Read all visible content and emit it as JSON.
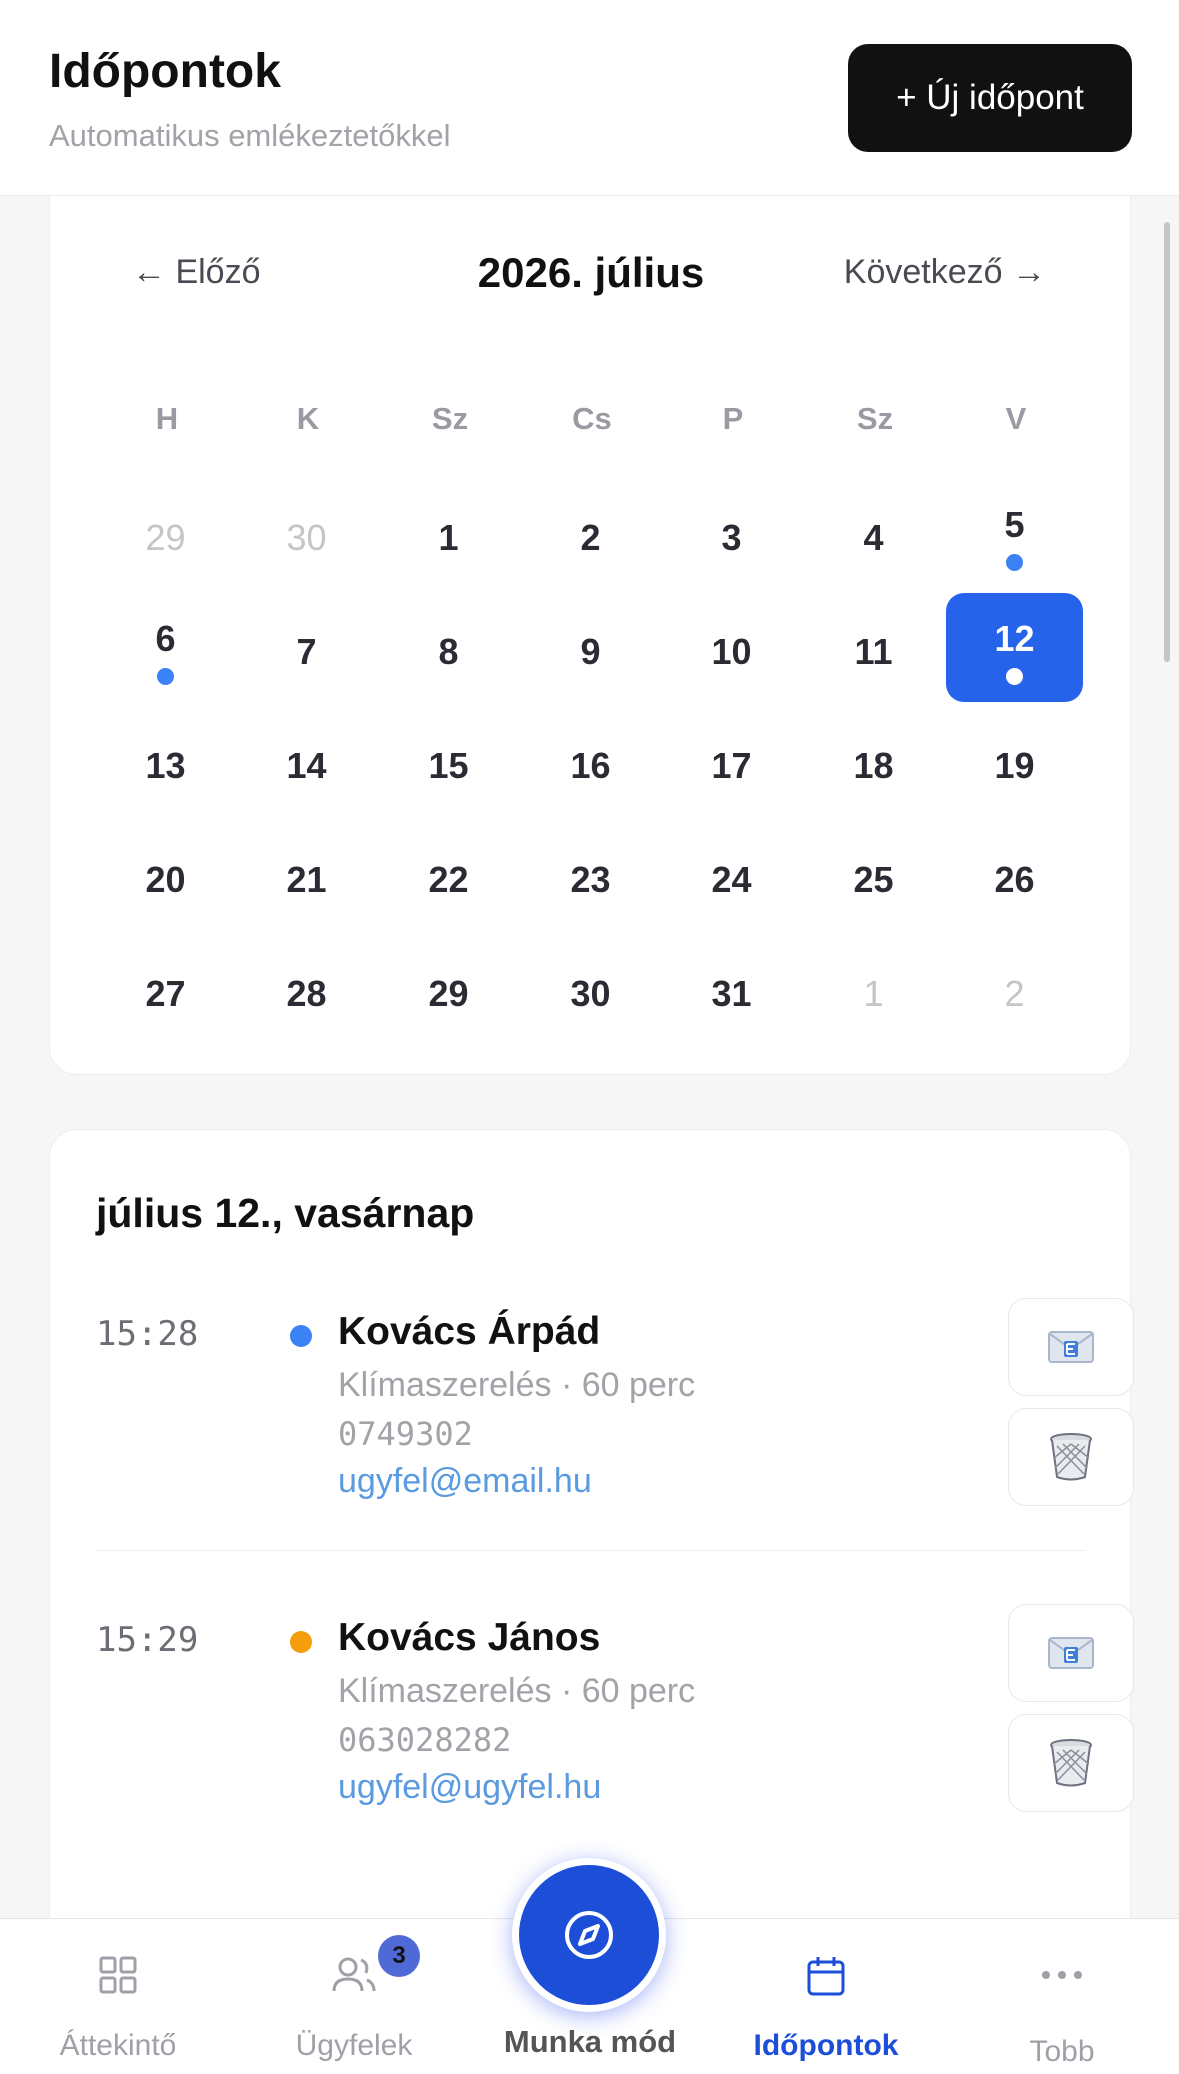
{
  "header": {
    "title": "Időpontok",
    "subtitle": "Automatikus emlékeztetőkkel",
    "new_button": "+ Új időpont"
  },
  "calendar": {
    "prev": "← Előző",
    "month": "2026. július",
    "next": "Következő →",
    "weekdays": [
      "H",
      "K",
      "Sz",
      "Cs",
      "P",
      "Sz",
      "V"
    ],
    "weeks": [
      [
        {
          "d": "29",
          "muted": true
        },
        {
          "d": "30",
          "muted": true
        },
        {
          "d": "1"
        },
        {
          "d": "2"
        },
        {
          "d": "3"
        },
        {
          "d": "4"
        },
        {
          "d": "5",
          "dot": true
        }
      ],
      [
        {
          "d": "6",
          "dot": true
        },
        {
          "d": "7"
        },
        {
          "d": "8"
        },
        {
          "d": "9"
        },
        {
          "d": "10"
        },
        {
          "d": "11"
        },
        {
          "d": "12",
          "dot": true,
          "selected": true
        }
      ],
      [
        {
          "d": "13"
        },
        {
          "d": "14"
        },
        {
          "d": "15"
        },
        {
          "d": "16"
        },
        {
          "d": "17"
        },
        {
          "d": "18"
        },
        {
          "d": "19"
        }
      ],
      [
        {
          "d": "20"
        },
        {
          "d": "21"
        },
        {
          "d": "22"
        },
        {
          "d": "23"
        },
        {
          "d": "24"
        },
        {
          "d": "25"
        },
        {
          "d": "26"
        }
      ],
      [
        {
          "d": "27"
        },
        {
          "d": "28"
        },
        {
          "d": "29"
        },
        {
          "d": "30"
        },
        {
          "d": "31"
        },
        {
          "d": "1",
          "muted": true
        },
        {
          "d": "2",
          "muted": true
        }
      ]
    ]
  },
  "day": {
    "title": "július 12., vasárnap",
    "appointments": [
      {
        "time": "15:28",
        "name": "Kovács Árpád",
        "service": "Klímaszerelés · 60 perc",
        "phone": "0749302",
        "email": "ugyfel@email.hu",
        "status_color": "#3b82f6",
        "actions": [
          "email-icon",
          "trash-icon"
        ]
      },
      {
        "time": "15:29",
        "name": "Kovács János",
        "service": "Klímaszerelés · 60 perc",
        "phone": "063028282",
        "email": "ugyfel@ugyfel.hu",
        "status_color": "#f59e0b",
        "actions": [
          "email-icon",
          "trash-icon"
        ]
      }
    ]
  },
  "tabs": {
    "overview": "Áttekintő",
    "clients": "Ügyfelek",
    "clients_badge": "3",
    "work_mode": "Munka mód",
    "appointments": "Időpontok",
    "more": "Tobb"
  },
  "colors": {
    "accent": "#2563eb",
    "fab": "#1d4ed8",
    "active_tab": "#1d4ed8"
  }
}
